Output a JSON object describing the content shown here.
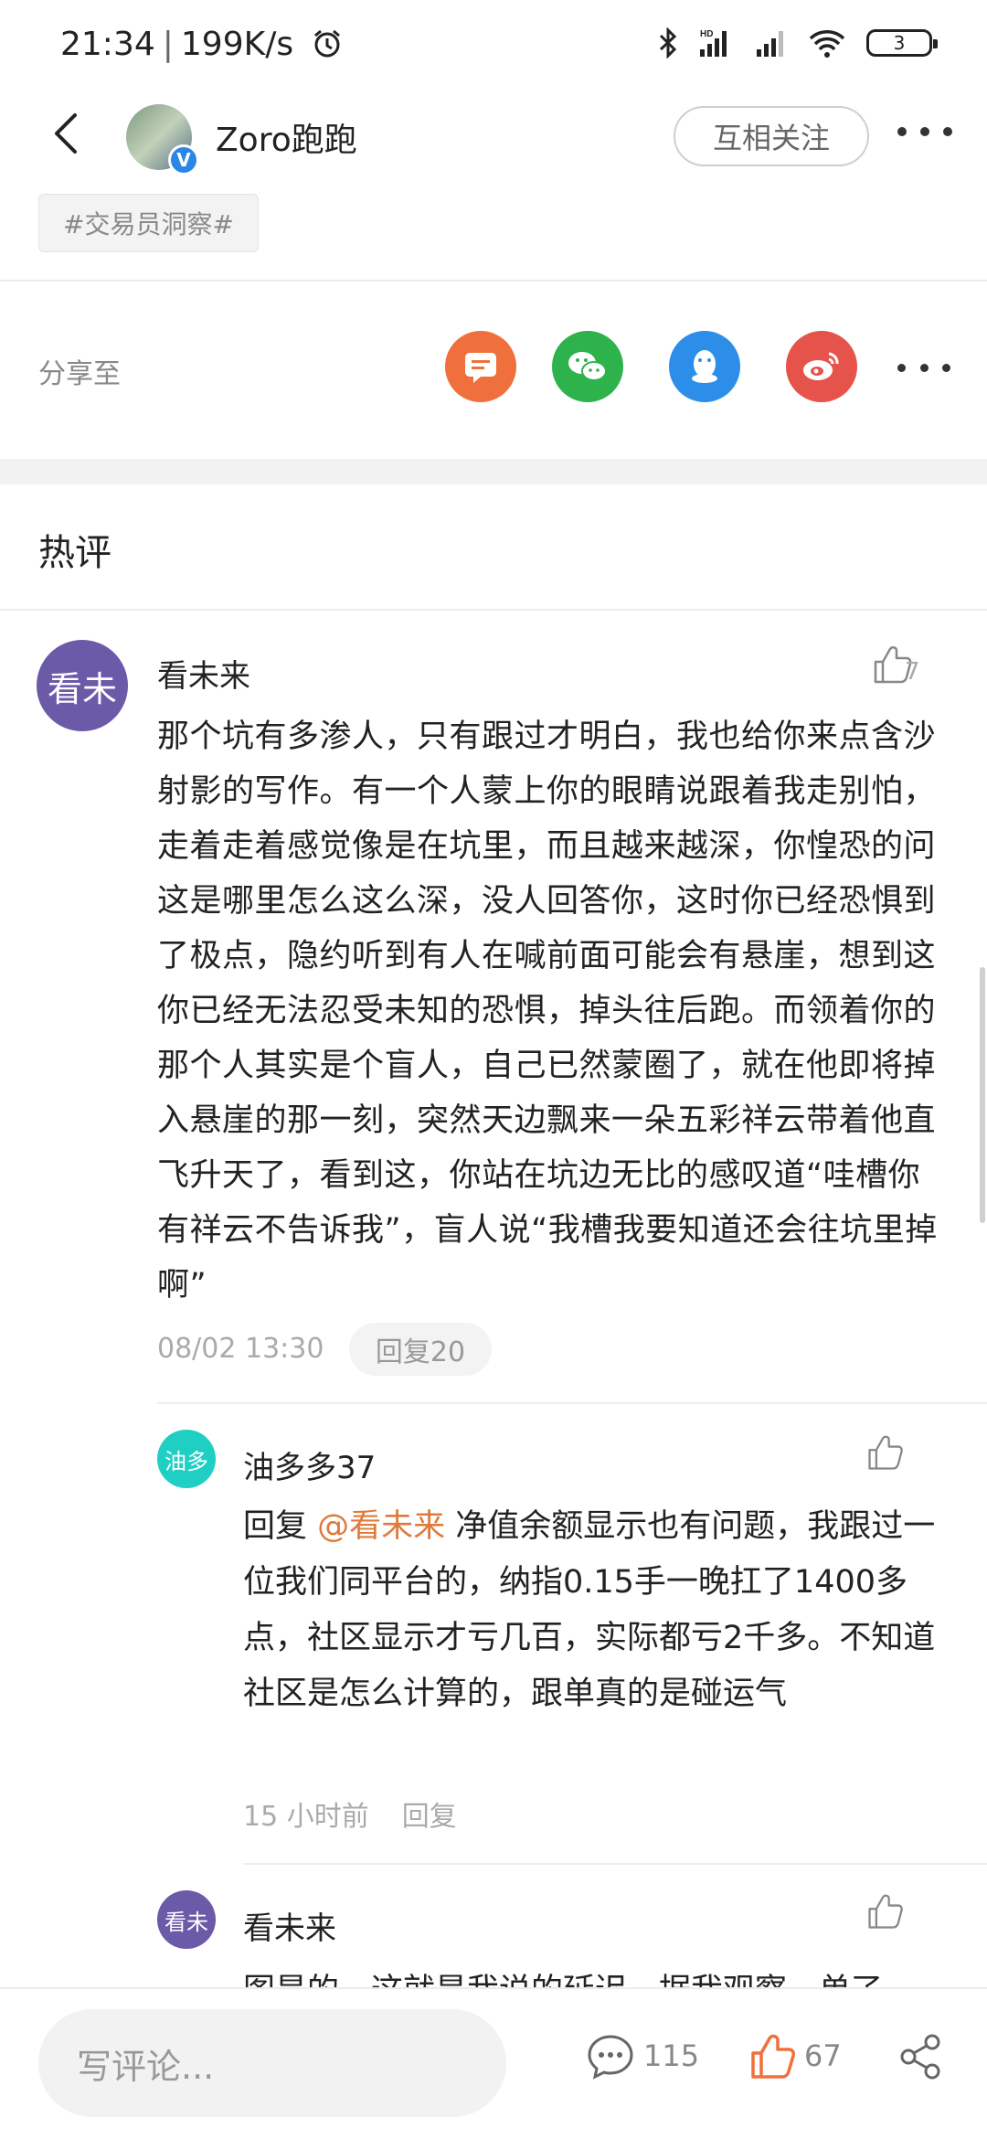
{
  "status_bar": {
    "time": "21:34",
    "net_speed": "199K/s",
    "battery": "3"
  },
  "header": {
    "username": "Zoro跑跑",
    "follow_label": "互相关注"
  },
  "tag": "#交易员洞察#",
  "share": {
    "label": "分享至"
  },
  "section_title": "热评",
  "comment": {
    "avatar_text": "看未",
    "author": "看未来",
    "like_count": "7",
    "body": "那个坑有多渗人，只有跟过才明白，我也给你来点含沙射影的写作。有一个人蒙上你的眼睛说跟着我走别怕，走着走着感觉像是在坑里，而且越来越深，你惶恐的问这是哪里怎么这么深，没人回答你，这时你已经恐惧到了极点，隐约听到有人在喊前面可能会有悬崖，想到这你已经无法忍受未知的恐惧，掉头往后跑。而领着你的那个人其实是个盲人，自己已然蒙圈了，就在他即将掉入悬崖的那一刻，突然天边飘来一朵五彩祥云带着他直飞升天了，看到这，你站在坑边无比的感叹道“哇槽你有祥云不告诉我”，盲人说“我槽我要知道还会往坑里掉啊”",
    "time": "08/02 13:30",
    "reply_button": "回复20"
  },
  "replies": [
    {
      "avatar_text": "油多",
      "author": "油多多37",
      "reply_prefix": "回复 ",
      "mention": "@看未来",
      "body": " 净值余额显示也有问题，我跟过一位我们同平台的，纳指0.15手一晚扛了1400多点，社区显示才亏几百，实际都亏2千多。不知道社区是怎么计算的，跟单真的是碰运气",
      "time": "15 小时前",
      "reply_label": "回复"
    },
    {
      "avatar_text": "看未",
      "author": "看未来",
      "body": "图是的，这就是我说的延迟，据我观察，单了"
    }
  ],
  "bottom_bar": {
    "input_placeholder": "写评论...",
    "comment_count": "115",
    "like_count": "67"
  },
  "colors": {
    "accent_orange": "#f0703d",
    "wechat_green": "#2eb24c",
    "qq_blue": "#2c8ee8",
    "weibo_red": "#e5534a",
    "mention": "#e07a3b"
  }
}
